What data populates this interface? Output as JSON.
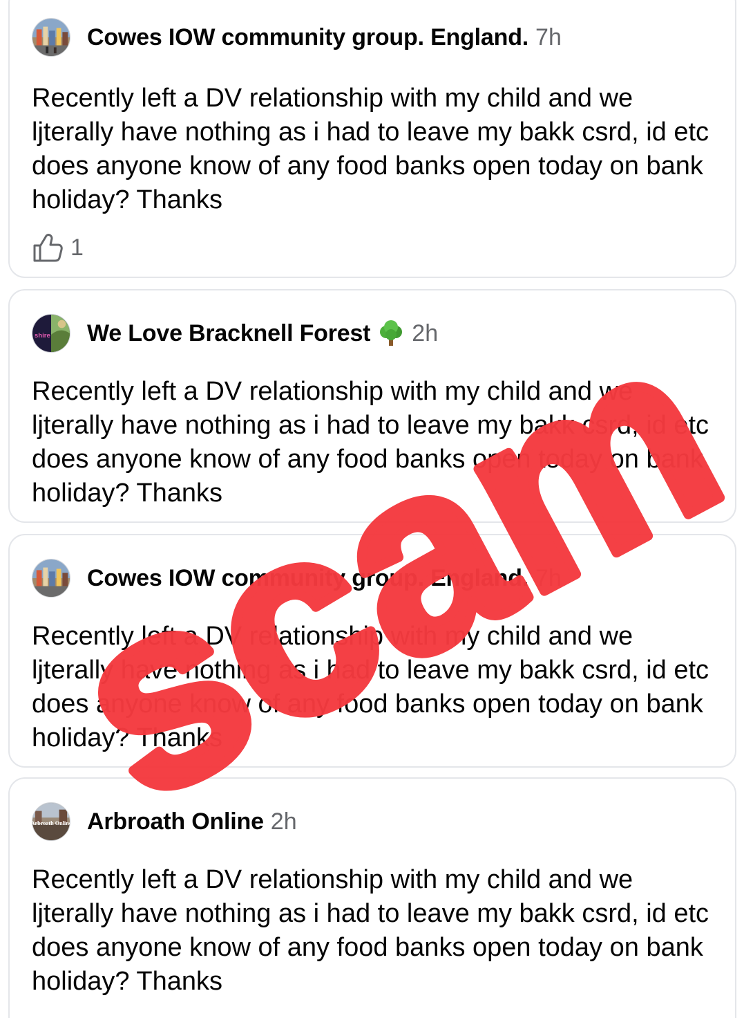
{
  "posts": [
    {
      "group": "Cowes IOW community group. England.",
      "time": "7h",
      "emoji": "",
      "avatar_icon": "cowes-town-photo",
      "body": "Recently left a DV relationship with my child and we ljterally have nothing as i had to leave my bakk csrd, id etc does anyone know of any food banks open today on bank holiday? Thanks",
      "like_count": "1"
    },
    {
      "group": "We Love Bracknell Forest",
      "time": "2h",
      "emoji": "tree-emoji",
      "avatar_icon": "bracknell-logo",
      "avatar_text": "shire",
      "body": "Recently left a DV relationship with my child and we ljterally have nothing as i had to leave my bakk csrd, id etc does anyone know of any food banks open today on bank holiday? Thanks"
    },
    {
      "group": "Cowes IOW community group. England.",
      "time": "7h",
      "emoji": "",
      "avatar_icon": "cowes-town-photo",
      "body": "Recently left a DV relationship with my child and we ljterally have nothing as i had to leave my bakk csrd, id etc does anyone know of any food banks open today on bank holiday? Thanks"
    },
    {
      "group": "Arbroath Online",
      "time": "2h",
      "emoji": "",
      "avatar_icon": "arbroath-online-logo",
      "avatar_text": "Arbroath Online",
      "body": "Recently left a DV relationship with my child and we ljterally have nothing as i had to leave my bakk csrd, id etc does anyone know of any food banks open today on bank holiday? Thanks"
    }
  ],
  "stamp": {
    "text": "scam",
    "color": "#f43a3f"
  },
  "colors": {
    "text_primary": "#050505",
    "text_secondary": "#65676b",
    "card_border": "#e4e6ea"
  }
}
